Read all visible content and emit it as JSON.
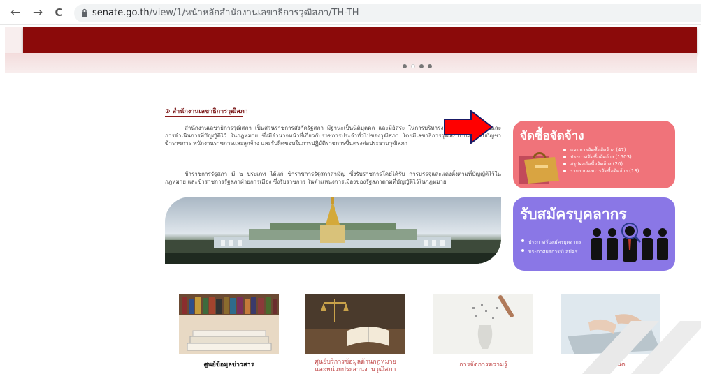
{
  "browser": {
    "url_domain": "senate.go.th",
    "url_path": "/view/1/หน้าหลักสำนักงานเลขาธิการวุฒิสภา/TH-TH",
    "back_glyph": "←",
    "forward_glyph": "→",
    "reload_glyph": "C"
  },
  "article": {
    "section_title": "⊙ สำนักงานเลขาธิการวุฒิสภา",
    "paragraph_1": "สำนักงานเลขาธิการวุฒิสภา เป็นส่วนราชการสังกัดรัฐสภา มีฐานะเป็นนิติบุคคล และมีอิสระ ในการบริหารงาน การงบประมาณและการดำเนินการที่บัญญัติไว้ ในกฎหมาย ซึ่งมีอำนาจหน้าที่เกี่ยวกับราชการประจำทั่วไปของวุฒิสภา โดยมีเลขาธิการวุฒิสภาเป็นผู้บังคับบัญชาข้าราชการ พนักงานราชการและลูกจ้าง และรับผิดชอบในการปฏิบัติราชการขึ้นตรงต่อประธานวุฒิสภา",
    "paragraph_2": "ข้าราชการรัฐสภา มี ๒ ประเภท ได้แก่ ข้าราชการรัฐสภาสามัญ ซึ่งรับราชการโดยได้รับ การบรรจุและแต่งตั้งตามที่บัญญัติไว้ในกฎหมาย และข้าราชการรัฐสภาฝ่ายการเมือง ซึ่งรับราชการ ในตำแหน่งการเมืองของรัฐสภาตามที่บัญญัติไว้ในกฎหมาย"
  },
  "procurement": {
    "title": "จัดซื้อจัดจ้าง",
    "items": [
      "แผนการจัดซื้อจัดจ้าง (47)",
      "ประกาศจัดซื้อจัดจ้าง (1503)",
      "สรุปผลจัดซื้อจัดจ้าง (20)",
      "รายงานผลการจัดซื้อจัดจ้าง (13)"
    ],
    "color": "#f0737a"
  },
  "recruitment": {
    "title": "รับสมัครบุคลากร",
    "items": [
      "ประกาศรับสมัครบุคลากร",
      "ประกาศผลการรับสมัคร"
    ],
    "color": "#8a77e6"
  },
  "tiles": [
    {
      "line1": "ศูนย์ข้อมูลข่าวสาร",
      "line2": ""
    },
    {
      "line1": "ศูนย์บริการข้อมูลด้านกฎหมาย",
      "line2": "และหน่วยประสานงานวุฒิสภา"
    },
    {
      "line1": "การจัดการความรู้",
      "line2": ""
    },
    {
      "line1": "อินทราเน็ต",
      "line2": ""
    }
  ],
  "carousel": {
    "slide_count": 4,
    "active_index": 1
  },
  "colors": {
    "brand_red": "#8b0a0a",
    "arrow_red": "#ff0000"
  }
}
